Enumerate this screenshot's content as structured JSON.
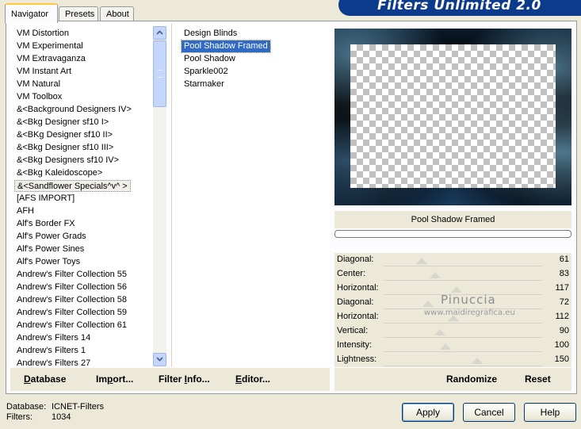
{
  "header": {
    "title": "Filters Unlimited 2.0"
  },
  "tabs": [
    {
      "label": "Navigator",
      "active": true
    },
    {
      "label": "Presets",
      "active": false
    },
    {
      "label": "About",
      "active": false
    }
  ],
  "categories": {
    "selected_index": 12,
    "items": [
      "VM Distortion",
      "VM Experimental",
      "VM Extravaganza",
      "VM Instant Art",
      "VM Natural",
      "VM Toolbox",
      "&<Background Designers IV>",
      "&<Bkg Designer sf10 I>",
      "&<BKg Designer sf10 II>",
      "&<Bkg Designer sf10 III>",
      "&<Bkg Designers sf10 IV>",
      "&<Bkg Kaleidoscope>",
      "&<Sandflower Specials^v^ >",
      "[AFS IMPORT]",
      "AFH",
      "Alf's Border FX",
      "Alf's Power Grads",
      "Alf's Power Sines",
      "Alf's Power Toys",
      "Andrew's Filter Collection 55",
      "Andrew's Filter Collection 56",
      "Andrew's Filter Collection 58",
      "Andrew's Filter Collection 59",
      "Andrew's Filter Collection 61",
      "Andrew's Filters 14",
      "Andrew's Filters 1",
      "Andrew's Filters 27"
    ]
  },
  "filters": {
    "selected_index": 1,
    "items": [
      "Design Blinds",
      "Pool Shadow Framed",
      "Pool Shadow",
      "Sparkle002",
      "Starmaker"
    ]
  },
  "preview": {
    "filter_name": "Pool Shadow Framed"
  },
  "sliders": [
    {
      "label": "Diagonal:",
      "value": "61",
      "level": 61
    },
    {
      "label": "Center:",
      "value": "83",
      "level": 83
    },
    {
      "label": "Horizontal:",
      "value": "117",
      "level": 117
    },
    {
      "label": "Diagonal:",
      "value": "72",
      "level": 72
    },
    {
      "label": "Horizontal:",
      "value": "112",
      "level": 112
    },
    {
      "label": "Vertical:",
      "value": "90",
      "level": 90
    },
    {
      "label": "Intensity:",
      "value": "100",
      "level": 100
    },
    {
      "label": "Lightness:",
      "value": "150",
      "level": 150
    }
  ],
  "toolbar": {
    "database": {
      "pre": "",
      "u": "D",
      "post": "atabase"
    },
    "import": {
      "pre": "Im",
      "u": "p",
      "post": "ort..."
    },
    "filter_info": {
      "pre": "Filter ",
      "u": "I",
      "post": "nfo..."
    },
    "editor": {
      "pre": "",
      "u": "E",
      "post": "ditor..."
    },
    "randomize": "Randomize",
    "reset": "Reset"
  },
  "watermark": {
    "name": "Pinuccia",
    "url": "www.maidiregrafica.eu"
  },
  "footer": {
    "database_label": "Database:",
    "database_value": "ICNET-Filters",
    "filters_label": "Filters:",
    "filters_value": "1034"
  },
  "buttons": {
    "apply": "Apply",
    "cancel": "Cancel",
    "help": "Help"
  }
}
